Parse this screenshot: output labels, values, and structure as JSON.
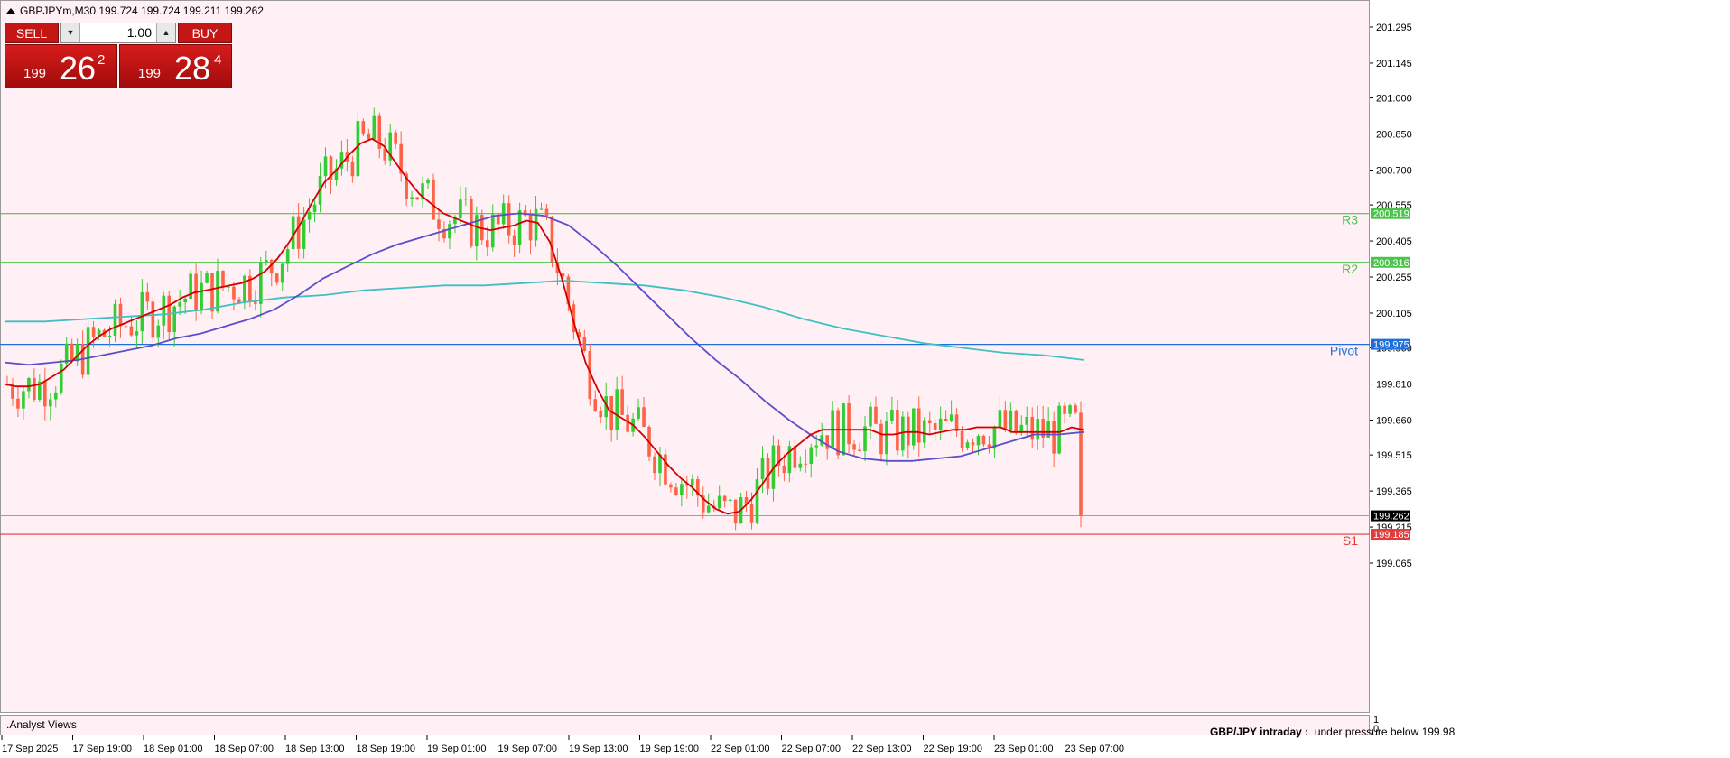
{
  "header": {
    "symbol_line": "GBPJPYm,M30  199.724 199.724 199.211 199.262"
  },
  "one_click": {
    "sell_label": "SELL",
    "buy_label": "BUY",
    "lot_value": "1.00",
    "sell_price": {
      "small": "199",
      "big": "26",
      "sup": "2"
    },
    "buy_price": {
      "small": "199",
      "big": "28",
      "sup": "4"
    }
  },
  "indicator_pane": {
    "label": ".Analyst Views",
    "scale_top": "1",
    "scale_bottom": "0",
    "analyst_title": "GBP/JPY intraday :",
    "analyst_text": "under pressure below 199.98"
  },
  "colors": {
    "background": "#fff0f5",
    "bull": "#32cd32",
    "bear": "#ff6347",
    "ma_fast": "#d40000",
    "ma_mid": "#5a4fc8",
    "ma_slow": "#40c0c0",
    "pivot": "#1e6fd9",
    "resistance": "#4cc44c",
    "support": "#e03c3c"
  },
  "chart_data": {
    "type": "candlestick",
    "symbol": "GBPJPYm",
    "timeframe": "M30",
    "ohlc_header": {
      "open": 199.724,
      "high": 199.724,
      "low": 199.211,
      "close": 199.262
    },
    "ylim": [
      198.99,
      201.37
    ],
    "y_ticks": [
      "201.295",
      "201.145",
      "201.000",
      "200.850",
      "200.700",
      "200.555",
      "200.405",
      "200.255",
      "200.105",
      "199.960",
      "199.810",
      "199.660",
      "199.515",
      "199.365",
      "199.215",
      "199.065"
    ],
    "x_ticks": [
      "17 Sep 2025",
      "17 Sep 19:00",
      "18 Sep 01:00",
      "18 Sep 07:00",
      "18 Sep 13:00",
      "18 Sep 19:00",
      "19 Sep 01:00",
      "19 Sep 07:00",
      "19 Sep 13:00",
      "19 Sep 19:00",
      "22 Sep 01:00",
      "22 Sep 07:00",
      "22 Sep 13:00",
      "22 Sep 19:00",
      "23 Sep 01:00",
      "23 Sep 07:00"
    ],
    "levels": [
      {
        "name": "R3",
        "value": 200.519,
        "label": "200.519",
        "color": "#4cc44c"
      },
      {
        "name": "R2",
        "value": 200.316,
        "label": "200.316",
        "color": "#4cc44c"
      },
      {
        "name": "Pivot",
        "value": 199.975,
        "label": "199.975",
        "color": "#1e6fd9"
      },
      {
        "name": "S1",
        "value": 199.185,
        "label": "199.185",
        "color": "#e03c3c"
      }
    ],
    "current_price": {
      "value": 199.262,
      "label": "199.262"
    },
    "ma_fast": [
      199.81,
      199.8,
      199.8,
      199.81,
      199.84,
      199.87,
      199.92,
      199.97,
      200.01,
      200.04,
      200.06,
      200.08,
      200.1,
      200.12,
      200.14,
      200.17,
      200.19,
      200.2,
      200.21,
      200.22,
      200.23,
      200.25,
      200.28,
      200.33,
      200.4,
      200.48,
      200.57,
      200.65,
      200.7,
      200.76,
      200.81,
      200.83,
      200.8,
      200.73,
      200.66,
      200.6,
      200.56,
      200.52,
      200.5,
      200.48,
      200.46,
      200.45,
      200.46,
      200.47,
      200.49,
      200.48,
      200.4,
      200.25,
      200.07,
      199.9,
      199.79,
      199.7,
      199.67,
      199.64,
      199.59,
      199.53,
      199.47,
      199.42,
      199.38,
      199.33,
      199.29,
      199.27,
      199.28,
      199.33,
      199.4,
      199.47,
      199.52,
      199.56,
      199.6,
      199.62,
      199.62,
      199.62,
      199.62,
      199.62,
      199.6,
      199.6,
      199.61,
      199.61,
      199.6,
      199.61,
      199.62,
      199.62,
      199.63,
      199.63,
      199.63,
      199.61,
      199.61,
      199.61,
      199.61,
      199.61,
      199.63,
      199.62
    ],
    "ma_mid": [
      199.9,
      199.89,
      199.9,
      199.91,
      199.93,
      199.95,
      199.97,
      200.0,
      200.02,
      200.05,
      200.08,
      200.12,
      200.18,
      200.25,
      200.3,
      200.35,
      200.39,
      200.42,
      200.45,
      200.48,
      200.51,
      200.52,
      200.51,
      200.47,
      200.39,
      200.3,
      200.2,
      200.1,
      200.0,
      199.91,
      199.83,
      199.74,
      199.66,
      199.59,
      199.53,
      199.5,
      199.49,
      199.49,
      199.5,
      199.51,
      199.54,
      199.57,
      199.6,
      199.6,
      199.61
    ],
    "ma_slow": [
      200.07,
      200.07,
      200.08,
      200.09,
      200.1,
      200.12,
      200.15,
      200.17,
      200.18,
      200.2,
      200.21,
      200.22,
      200.22,
      200.23,
      200.24,
      200.23,
      200.22,
      200.2,
      200.17,
      200.13,
      200.08,
      200.04,
      200.01,
      199.98,
      199.96,
      199.94,
      199.93,
      199.91
    ]
  }
}
